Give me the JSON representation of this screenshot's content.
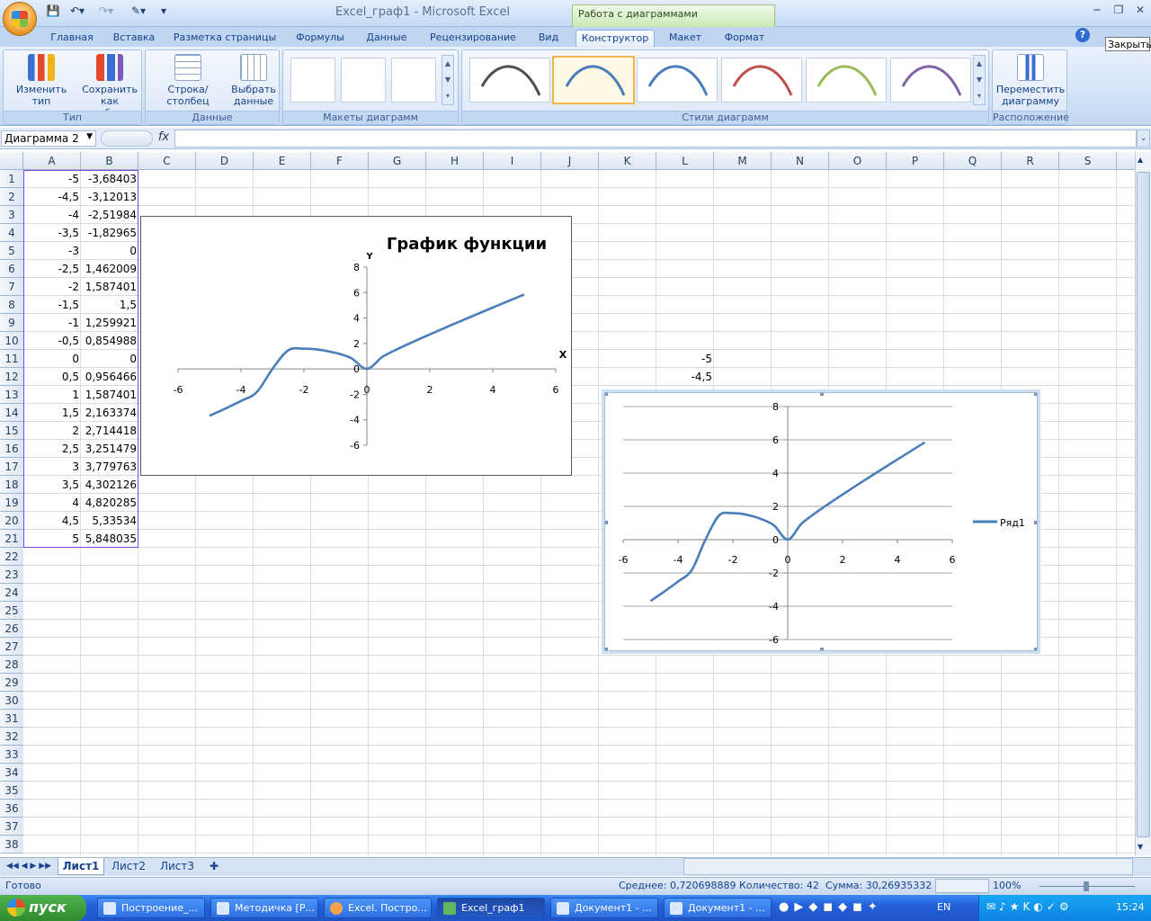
{
  "title": "Excel_граф1 - Microsoft Excel",
  "context_tab": "Работа с диаграммами",
  "tooltip": "Закрыть",
  "ribbon_tabs": [
    "Главная",
    "Вставка",
    "Разметка страницы",
    "Формулы",
    "Данные",
    "Рецензирование",
    "Вид",
    "Конструктор",
    "Макет",
    "Формат"
  ],
  "active_tab": "Конструктор",
  "groups": {
    "type": {
      "title": "Тип",
      "change_type": "Изменить тип диаграммы",
      "save_template": "Сохранить как шаблон"
    },
    "data": {
      "title": "Данные",
      "row_col": "Строка/столбец",
      "select_data": "Выбрать данные"
    },
    "layouts": {
      "title": "Макеты диаграмм"
    },
    "styles": {
      "title": "Стили диаграмм",
      "colors": [
        "#505050",
        "#4a7ebb",
        "#4a7ebb",
        "#c0504d",
        "#9bbb59",
        "#8064a2"
      ]
    },
    "location": {
      "title": "Расположение",
      "move": "Переместить диаграмму"
    }
  },
  "name_box": "Диаграмма 2",
  "fx": "fx",
  "columns": [
    "A",
    "B",
    "C",
    "D",
    "E",
    "F",
    "G",
    "H",
    "I",
    "J",
    "K",
    "L",
    "M",
    "N",
    "O",
    "P",
    "Q",
    "R",
    "S"
  ],
  "rows": [
    "1",
    "2",
    "3",
    "4",
    "5",
    "6",
    "7",
    "8",
    "9",
    "10",
    "11",
    "12",
    "13",
    "14",
    "15",
    "16",
    "17",
    "18",
    "19",
    "20",
    "21",
    "22",
    "23",
    "24",
    "25",
    "26",
    "27",
    "28",
    "29",
    "30",
    "31",
    "32",
    "33",
    "34",
    "35",
    "36",
    "37",
    "38"
  ],
  "col_a": [
    "-5",
    "-4,5",
    "-4",
    "-3,5",
    "-3",
    "-2,5",
    "-2",
    "-1,5",
    "-1",
    "-0,5",
    "0",
    "0,5",
    "1",
    "1,5",
    "2",
    "2,5",
    "3",
    "3,5",
    "4",
    "4,5",
    "5"
  ],
  "col_b": [
    "-3,68403",
    "-3,12013",
    "-2,51984",
    "-1,82965",
    "0",
    "1,462009",
    "1,587401",
    "1,5",
    "1,259921",
    "0,854988",
    "0",
    "0,956466",
    "1,587401",
    "2,163374",
    "2,714418",
    "3,251479",
    "3,779763",
    "4,302126",
    "4,820285",
    "5,33534",
    "5,848035"
  ],
  "col_l": [
    "-5",
    "-4,5"
  ],
  "sheets": [
    "Лист1",
    "Лист2",
    "Лист3"
  ],
  "active_sheet": "Лист1",
  "status": {
    "ready": "Готово",
    "average": "Среднее: 0,720698889",
    "count": "Количество: 42",
    "sum": "Сумма: 30,26935332",
    "zoom": "100%"
  },
  "taskbar": {
    "start": "пуск",
    "tasks": [
      "Построение_...",
      "Методичка [Р...",
      "Excel. Постро...",
      "Excel_граф1",
      "Документ1 - ...",
      "Документ1 - ..."
    ],
    "active_task": "Excel_граф1",
    "lang": "EN",
    "time": "15:24"
  },
  "chart_data": [
    {
      "type": "line",
      "title": "График функции",
      "xlabel": "X",
      "ylabel": "Y",
      "xlim": [
        -6,
        6
      ],
      "ylim": [
        -6,
        8
      ],
      "xticks": [
        "-6",
        "-4",
        "-2",
        "0",
        "2",
        "4",
        "6"
      ],
      "yticks": [
        "8",
        "6",
        "4",
        "2",
        "0",
        "-2",
        "-4",
        "-6"
      ],
      "grid": false,
      "series": [
        {
          "values": [
            -3.68403,
            -3.12013,
            -2.51984,
            -1.82965,
            0,
            1.462009,
            1.587401,
            1.5,
            1.259921,
            0.854988,
            0,
            0.956466,
            1.587401,
            2.163374,
            2.714418,
            3.251479,
            3.779763,
            4.302126,
            4.820285,
            5.33534,
            5.848035
          ]
        }
      ],
      "x": [
        -5,
        -4.5,
        -4,
        -3.5,
        -3,
        -2.5,
        -2,
        -1.5,
        -1,
        -0.5,
        0,
        0.5,
        1,
        1.5,
        2,
        2.5,
        3,
        3.5,
        4,
        4.5,
        5
      ]
    },
    {
      "type": "line",
      "xlim": [
        -6,
        6
      ],
      "ylim": [
        -6,
        8
      ],
      "xticks": [
        "-6",
        "-4",
        "-2",
        "0",
        "2",
        "4",
        "6"
      ],
      "yticks": [
        "8",
        "6",
        "4",
        "2",
        "0",
        "-2",
        "-4",
        "-6"
      ],
      "grid": true,
      "legend": "right",
      "series": [
        {
          "name": "Ряд1",
          "values": [
            -3.68403,
            -3.12013,
            -2.51984,
            -1.82965,
            0,
            1.462009,
            1.587401,
            1.5,
            1.259921,
            0.854988,
            0,
            0.956466,
            1.587401,
            2.163374,
            2.714418,
            3.251479,
            3.779763,
            4.302126,
            4.820285,
            5.33534,
            5.848035
          ]
        }
      ],
      "x": [
        -5,
        -4.5,
        -4,
        -3.5,
        -3,
        -2.5,
        -2,
        -1.5,
        -1,
        -0.5,
        0,
        0.5,
        1,
        1.5,
        2,
        2.5,
        3,
        3.5,
        4,
        4.5,
        5
      ]
    }
  ]
}
